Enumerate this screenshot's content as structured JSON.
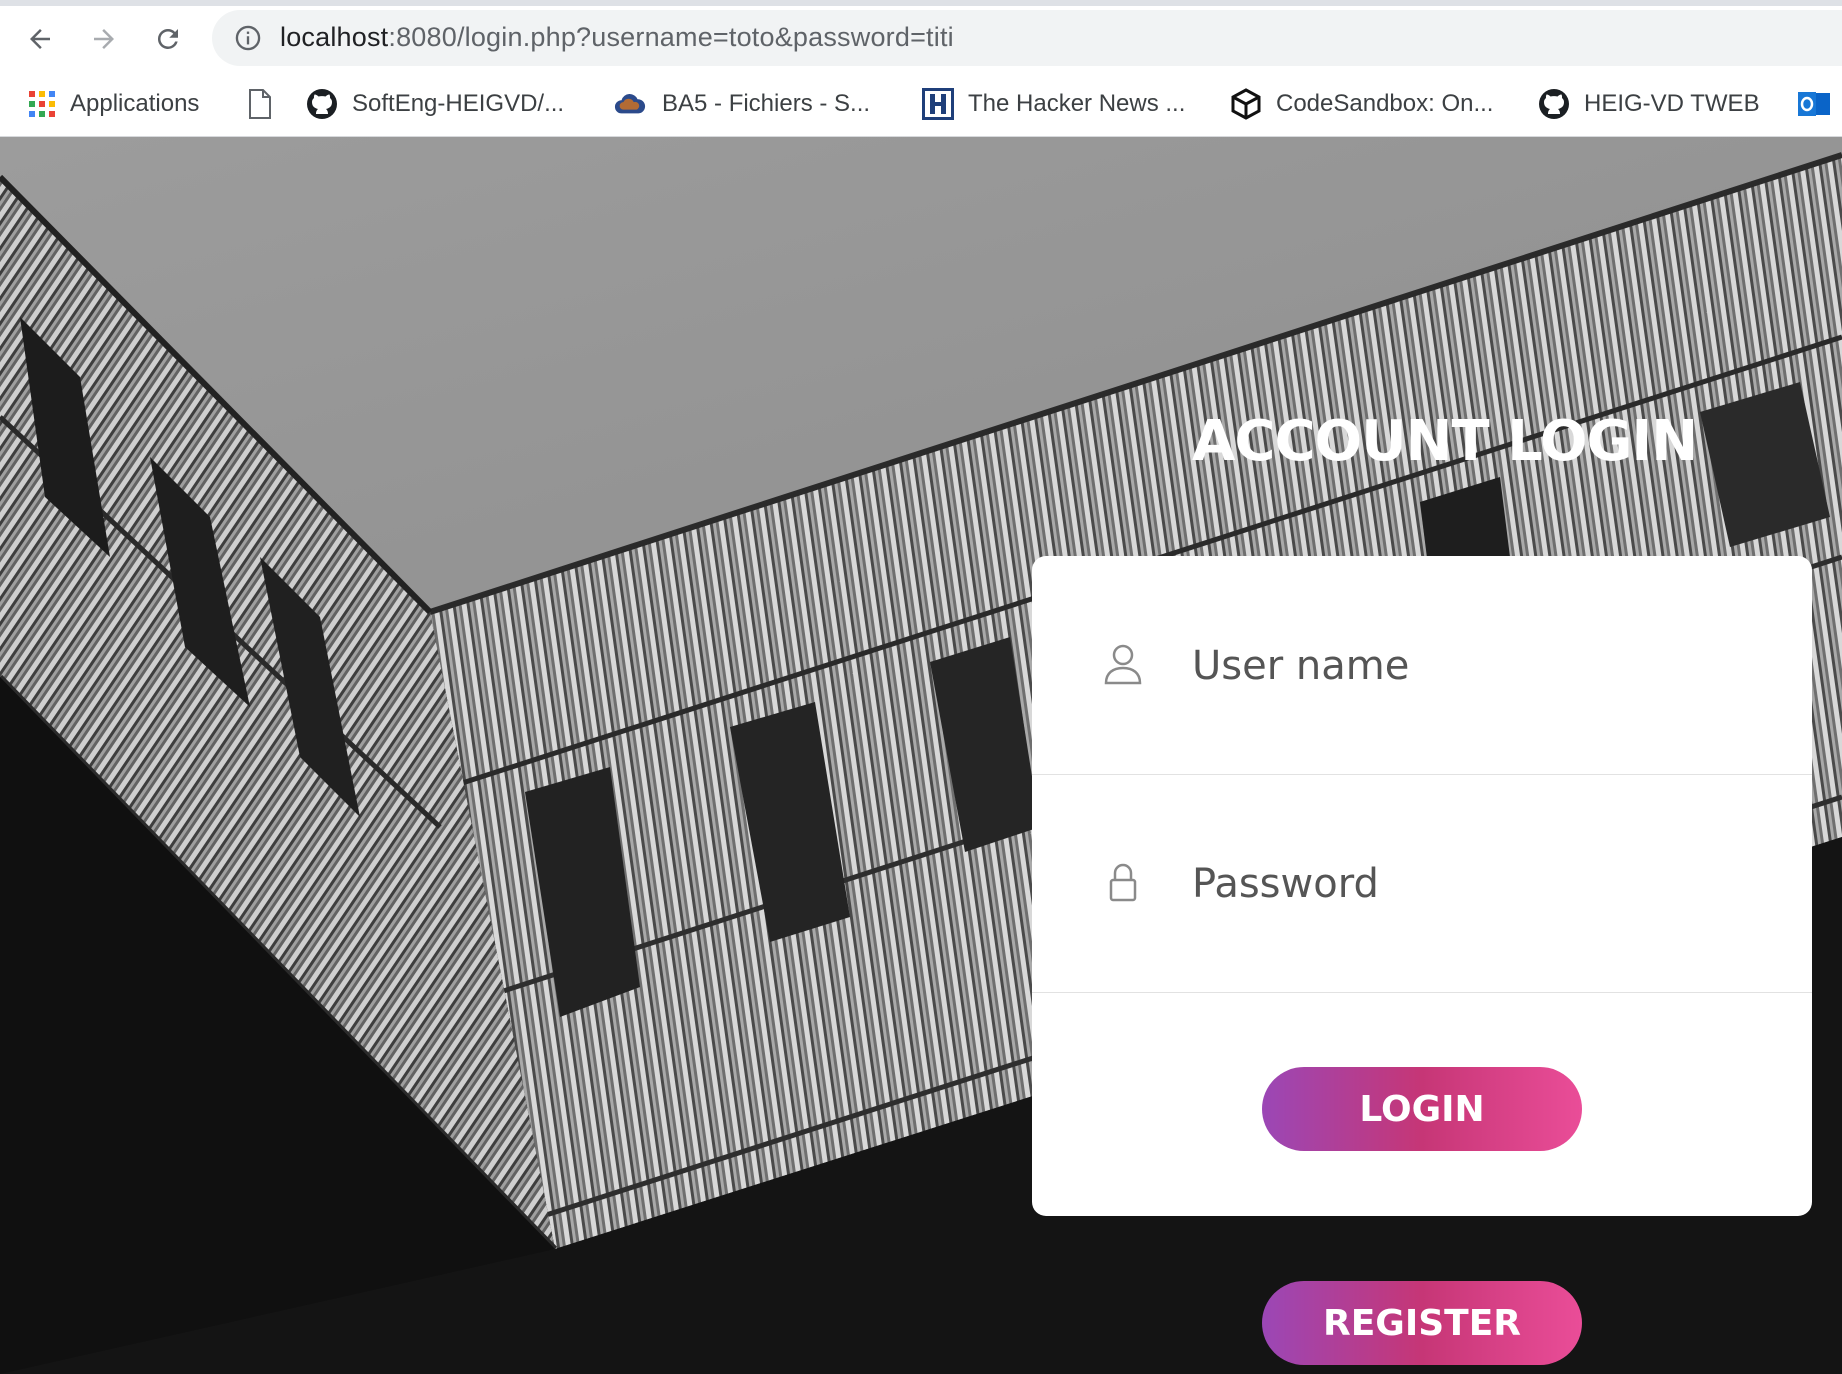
{
  "browser": {
    "url_host": "localhost",
    "url_rest": ":8080/login.php?username=toto&password=titi",
    "bookmarks": [
      {
        "label": "Applications",
        "icon": "apps-grid-icon"
      },
      {
        "label": "",
        "icon": "page-icon"
      },
      {
        "label": "SoftEng-HEIGVD/...",
        "icon": "github-icon"
      },
      {
        "label": "BA5 - Fichiers - S...",
        "icon": "cloud-icon"
      },
      {
        "label": "The Hacker News ...",
        "icon": "hacker-news-icon"
      },
      {
        "label": "CodeSandbox: On...",
        "icon": "codesandbox-icon"
      },
      {
        "label": "HEIG-VD TWEB",
        "icon": "github-icon"
      },
      {
        "label": "",
        "icon": "outlook-icon"
      }
    ]
  },
  "login": {
    "title": "ACCOUNT LOGIN",
    "username_placeholder": "User name",
    "password_placeholder": "Password",
    "login_button": "LOGIN",
    "register_button": "REGISTER"
  },
  "colors": {
    "button_gradient_start": "#9b47b6",
    "button_gradient_mid": "#c63676",
    "button_gradient_end": "#ea4d98"
  }
}
